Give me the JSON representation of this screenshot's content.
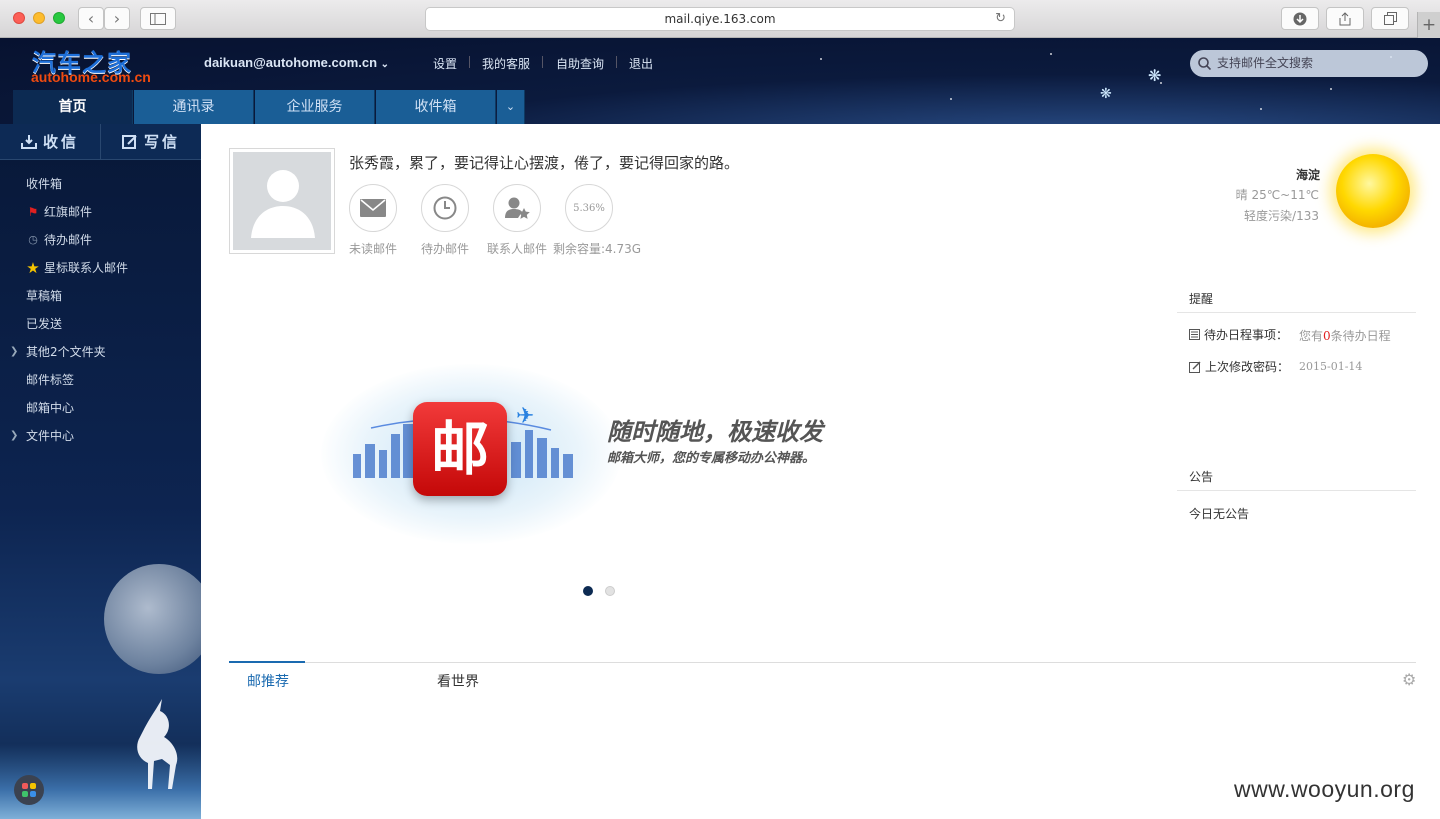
{
  "browser": {
    "url": "mail.qiye.163.com"
  },
  "header": {
    "logo_cn": "汽车之家",
    "logo_en": "autohome.com.cn",
    "user": "daikuan@autohome.com.cn",
    "links": [
      "设置",
      "我的客服",
      "自助查询",
      "退出"
    ],
    "search_placeholder": "支持邮件全文搜索",
    "tabs": [
      "首页",
      "通讯录",
      "企业服务",
      "收件箱"
    ]
  },
  "sidebar": {
    "receive": "收信",
    "compose": "写信",
    "folders": [
      "收件箱",
      "红旗邮件",
      "待办邮件",
      "星标联系人邮件",
      "草稿箱",
      "已发送",
      "其他2个文件夹",
      "邮件标签",
      "邮箱中心",
      "文件中心"
    ]
  },
  "profile": {
    "motto": "张秀霞，累了，要记得让心摆渡，倦了，要记得回家的路。",
    "stats": [
      {
        "label": "未读邮件",
        "icon": "envelope-icon"
      },
      {
        "label": "待办邮件",
        "icon": "clock-icon"
      },
      {
        "label": "联系人邮件",
        "icon": "contact-star-icon"
      },
      {
        "label": "剩余容量:4.73G",
        "value": "5.36%"
      }
    ]
  },
  "weather": {
    "city": "海淀",
    "condition": "晴 25℃~11℃",
    "air": "轻度污染/133"
  },
  "reminder": {
    "title": "提醒",
    "todo_label": "待办日程事项：",
    "todo_prefix": "您有",
    "todo_count": "0",
    "todo_suffix": "条待办日程",
    "pwd_label": "上次修改密码：",
    "pwd_date": "2015-01-14"
  },
  "notice": {
    "title": "公告",
    "text": "今日无公告"
  },
  "banner": {
    "icon_text": "邮",
    "title": "随时随地，极速收发",
    "subtitle": "邮箱大师，您的专属移动办公神器。"
  },
  "bottom_tabs": [
    "邮推荐",
    "看世界"
  ],
  "watermark": "www.wooyun.org",
  "colors": {
    "accent": "#1a6ab0",
    "nav_active": "#0c2a52",
    "flag": "#e02020",
    "star": "#f5c400"
  }
}
